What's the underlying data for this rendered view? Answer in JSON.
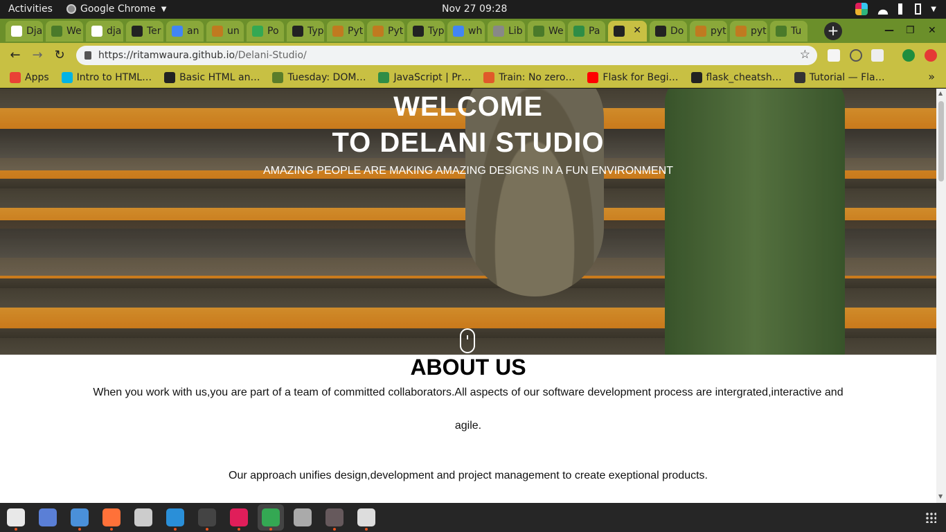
{
  "system": {
    "activities": "Activities",
    "app_name": "Google Chrome",
    "clock": "Nov 27  09:28"
  },
  "tabs": [
    {
      "label": "Dja",
      "color": "#ffffff"
    },
    {
      "label": "We",
      "color": "#4a7a2a"
    },
    {
      "label": "dja",
      "color": "#ffffff"
    },
    {
      "label": "Ter",
      "color": "#222222"
    },
    {
      "label": "an",
      "color": "#4285f4"
    },
    {
      "label": "un",
      "color": "#c07a20"
    },
    {
      "label": "Po",
      "color": "#34a853"
    },
    {
      "label": "Typ",
      "color": "#222222"
    },
    {
      "label": "Pyt",
      "color": "#c07a20"
    },
    {
      "label": "Pyt",
      "color": "#c07a20"
    },
    {
      "label": "Typ",
      "color": "#222222"
    },
    {
      "label": "wh",
      "color": "#4285f4"
    },
    {
      "label": "Lib",
      "color": "#888888"
    },
    {
      "label": "We",
      "color": "#4a7a2a"
    },
    {
      "label": "Pa",
      "color": "#2f8d46"
    },
    {
      "label": "",
      "color": "#222222",
      "active": true
    },
    {
      "label": "Do",
      "color": "#222222"
    },
    {
      "label": "pyt",
      "color": "#c07a20"
    },
    {
      "label": "pyt",
      "color": "#c07a20"
    },
    {
      "label": "Tu",
      "color": "#4a7a2a"
    }
  ],
  "toolbar": {
    "url_host": "https://ritamwaura.github.io",
    "url_path": "/Delani-Studio/"
  },
  "bookmarks": [
    {
      "label": "Apps",
      "color": "#e94235"
    },
    {
      "label": "Intro to HTML…",
      "color": "#02b3e4"
    },
    {
      "label": "Basic HTML an…",
      "color": "#222222"
    },
    {
      "label": "Tuesday: DOM…",
      "color": "#5b7d2a"
    },
    {
      "label": "JavaScript | Pr…",
      "color": "#2f8d46"
    },
    {
      "label": "Train: No zero…",
      "color": "#e05a2a"
    },
    {
      "label": "Flask for Begi…",
      "color": "#ff0000"
    },
    {
      "label": "flask_cheatsh…",
      "color": "#222222"
    },
    {
      "label": "Tutorial — Fla…",
      "color": "#333333"
    }
  ],
  "page": {
    "hero_title_line1": "WELCOME",
    "hero_title_line2": "TO DELANI STUDIO",
    "hero_subtitle": "AMAZING PEOPLE ARE MAKING AMAZING DESIGNS IN A FUN ENVIRONMENT",
    "about_title": "ABOUT US",
    "about_p1": "When you work with us,you are part of a team of committed collaborators.All aspects of our software development process are intergrated,interactive and agile.",
    "about_p2": "Our approach unifies design,development and project management to create exeptional products."
  },
  "dock": [
    {
      "name": "files",
      "color": "#e8e8e8",
      "running": true
    },
    {
      "name": "screenshot",
      "color": "#5a7fd6",
      "running": false
    },
    {
      "name": "text-editor",
      "color": "#4a90d9",
      "running": true
    },
    {
      "name": "firefox",
      "color": "#ff7139",
      "running": true
    },
    {
      "name": "software",
      "color": "#cccccc",
      "running": false
    },
    {
      "name": "vscode",
      "color": "#2a8fd8",
      "running": true
    },
    {
      "name": "terminal",
      "color": "#444444",
      "running": true
    },
    {
      "name": "slack",
      "color": "#e01e5a",
      "running": true
    },
    {
      "name": "chrome",
      "color": "#34a853",
      "running": true
    },
    {
      "name": "settings",
      "color": "#aaaaaa",
      "running": false
    },
    {
      "name": "atom",
      "color": "#66595c",
      "running": true
    },
    {
      "name": "maps",
      "color": "#dddddd",
      "running": true
    }
  ]
}
